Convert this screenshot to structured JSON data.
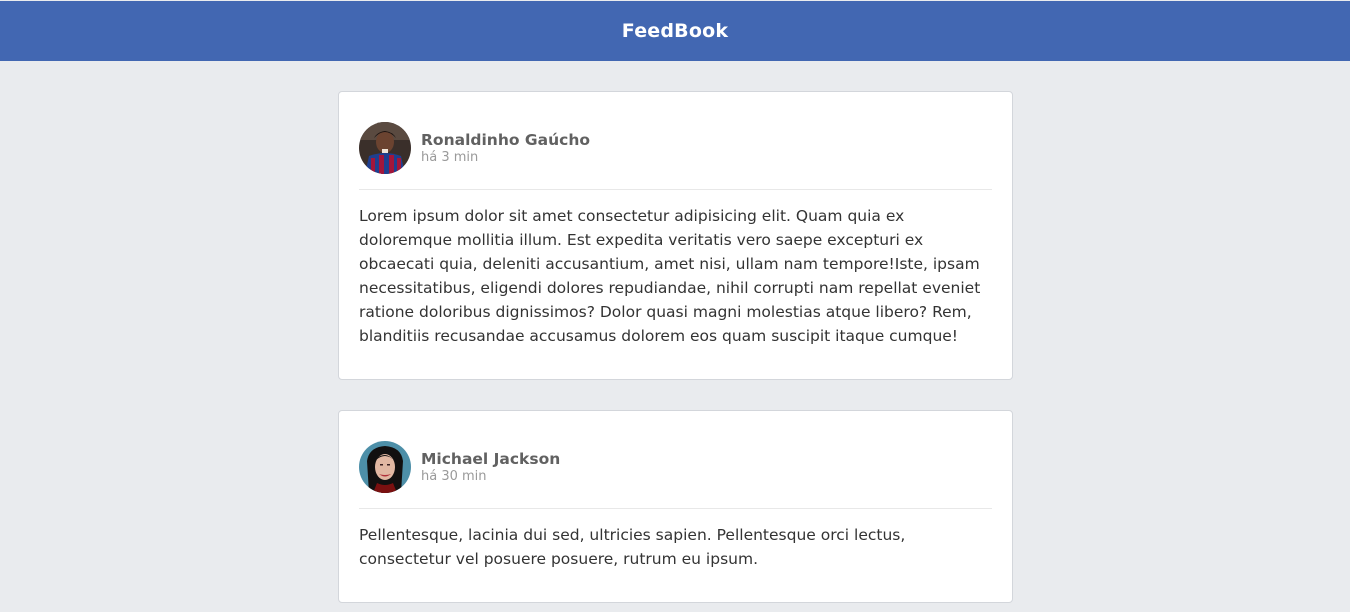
{
  "header": {
    "brand": "FeedBook"
  },
  "colors": {
    "brand_bar": "#4267b2",
    "page_background": "#e9ebee",
    "card_background": "#ffffff"
  },
  "posts": [
    {
      "author": "Ronaldinho Gaúcho",
      "time": "há 3 min",
      "avatar": "ronaldinho-avatar",
      "content": "Lorem ipsum dolor sit amet consectetur adipisicing elit. Quam quia ex doloremque mollitia illum. Est expedita veritatis vero saepe excepturi ex obcaecati quia, deleniti accusantium, amet nisi, ullam nam tempore!Iste, ipsam necessitatibus, eligendi dolores repudiandae, nihil corrupti nam repellat eveniet ratione doloribus dignissimos? Dolor quasi magni molestias atque libero? Rem, blanditiis recusandae accusamus dolorem eos quam suscipit itaque cumque!"
    },
    {
      "author": "Michael Jackson",
      "time": "há 30 min",
      "avatar": "michael-jackson-avatar",
      "content": "Pellentesque, lacinia dui sed, ultricies sapien. Pellentesque orci lectus, consectetur vel posuere posuere, rutrum eu ipsum."
    }
  ]
}
